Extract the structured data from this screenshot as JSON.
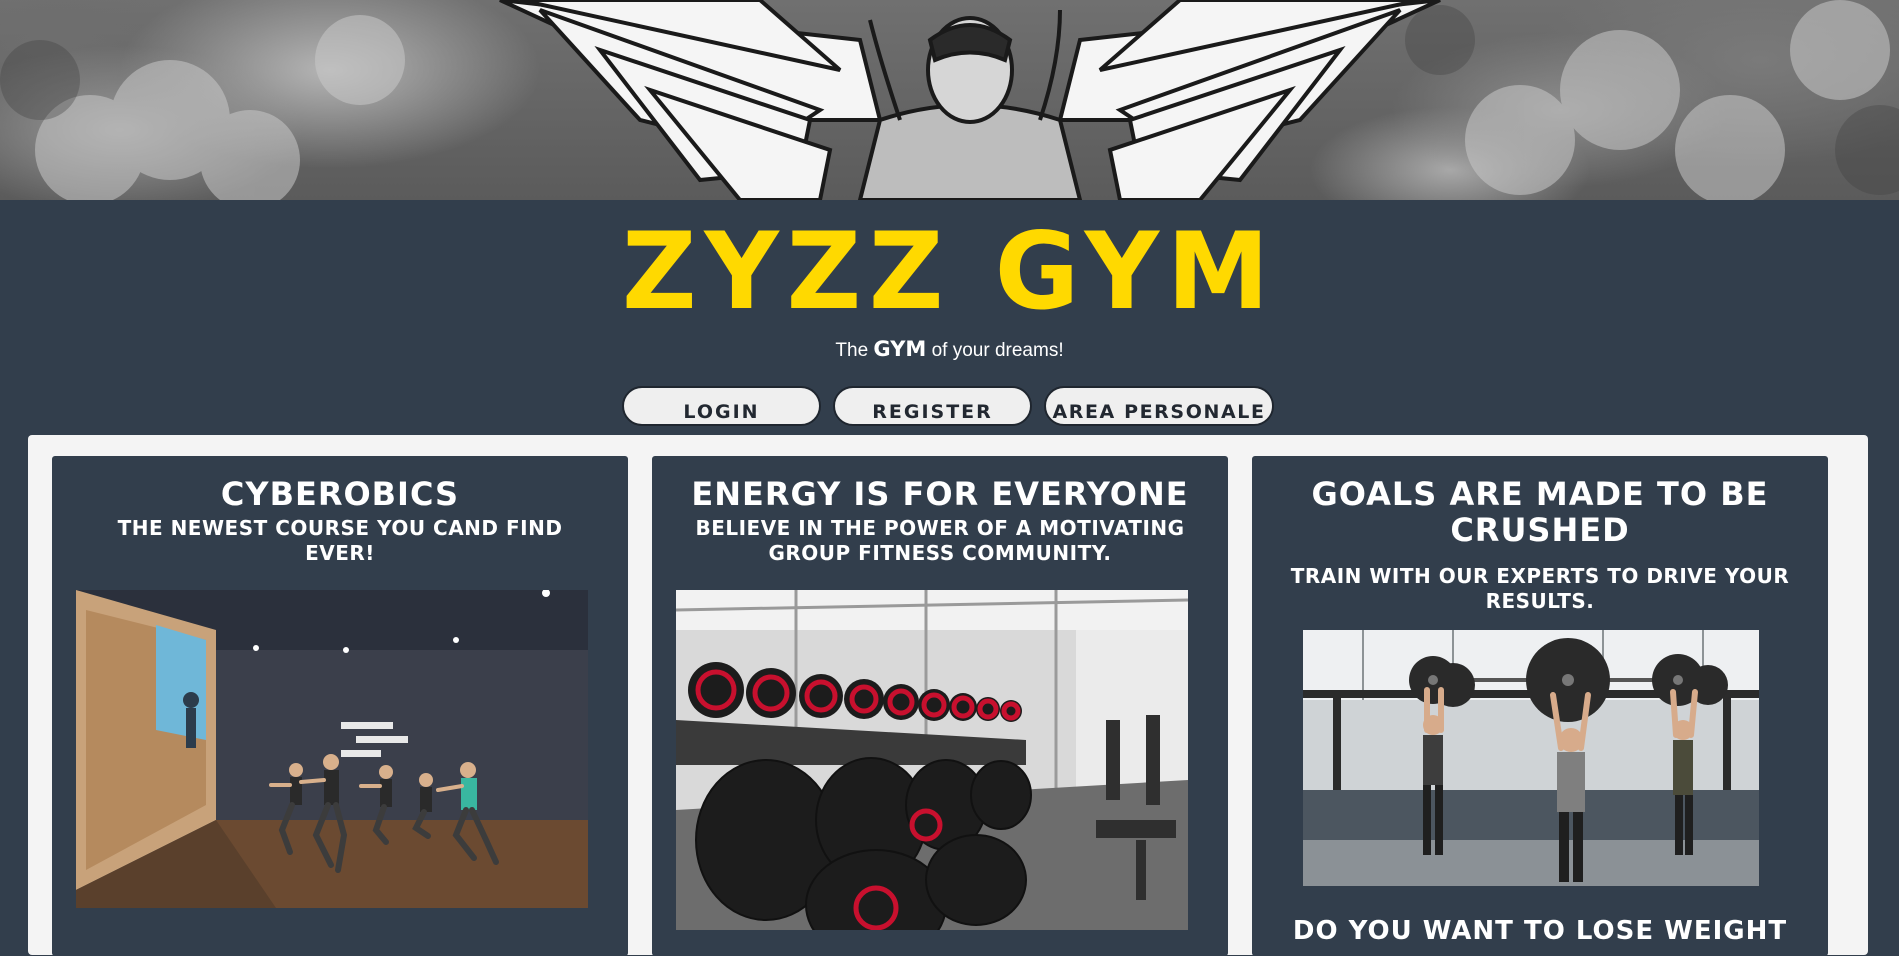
{
  "header": {
    "brand": "ZYZZ GYM",
    "tagline_before": "The",
    "tagline_strong": "GYM",
    "tagline_after": "of your dreams!"
  },
  "nav": {
    "login": "LOGIN",
    "register": "REGISTER",
    "personal_area": "AREA PERSONALE"
  },
  "cards": [
    {
      "title": "CYBEROBICS",
      "subtitle": "THE NEWEST COURSE YOU CAND FIND EVER!",
      "image": "fitness-class-photo"
    },
    {
      "title": "ENERGY IS FOR EVERYONE",
      "subtitle": "BELIEVE IN THE POWER OF A MOTIVATING GROUP FITNESS COMMUNITY.",
      "image": "dumbbell-rack-photo"
    },
    {
      "title": "GOALS ARE MADE TO BE CRUSHED",
      "subtitle": "TRAIN WITH OUR EXPERTS TO DRIVE YOUR RESULTS.",
      "image": "barbell-lift-photo",
      "teaser": "DO YOU WANT TO LOSE WEIGHT"
    }
  ],
  "colors": {
    "background": "#323e4c",
    "accent": "#ffd900",
    "panel": "#f4f4f4",
    "button": "#efefef"
  }
}
